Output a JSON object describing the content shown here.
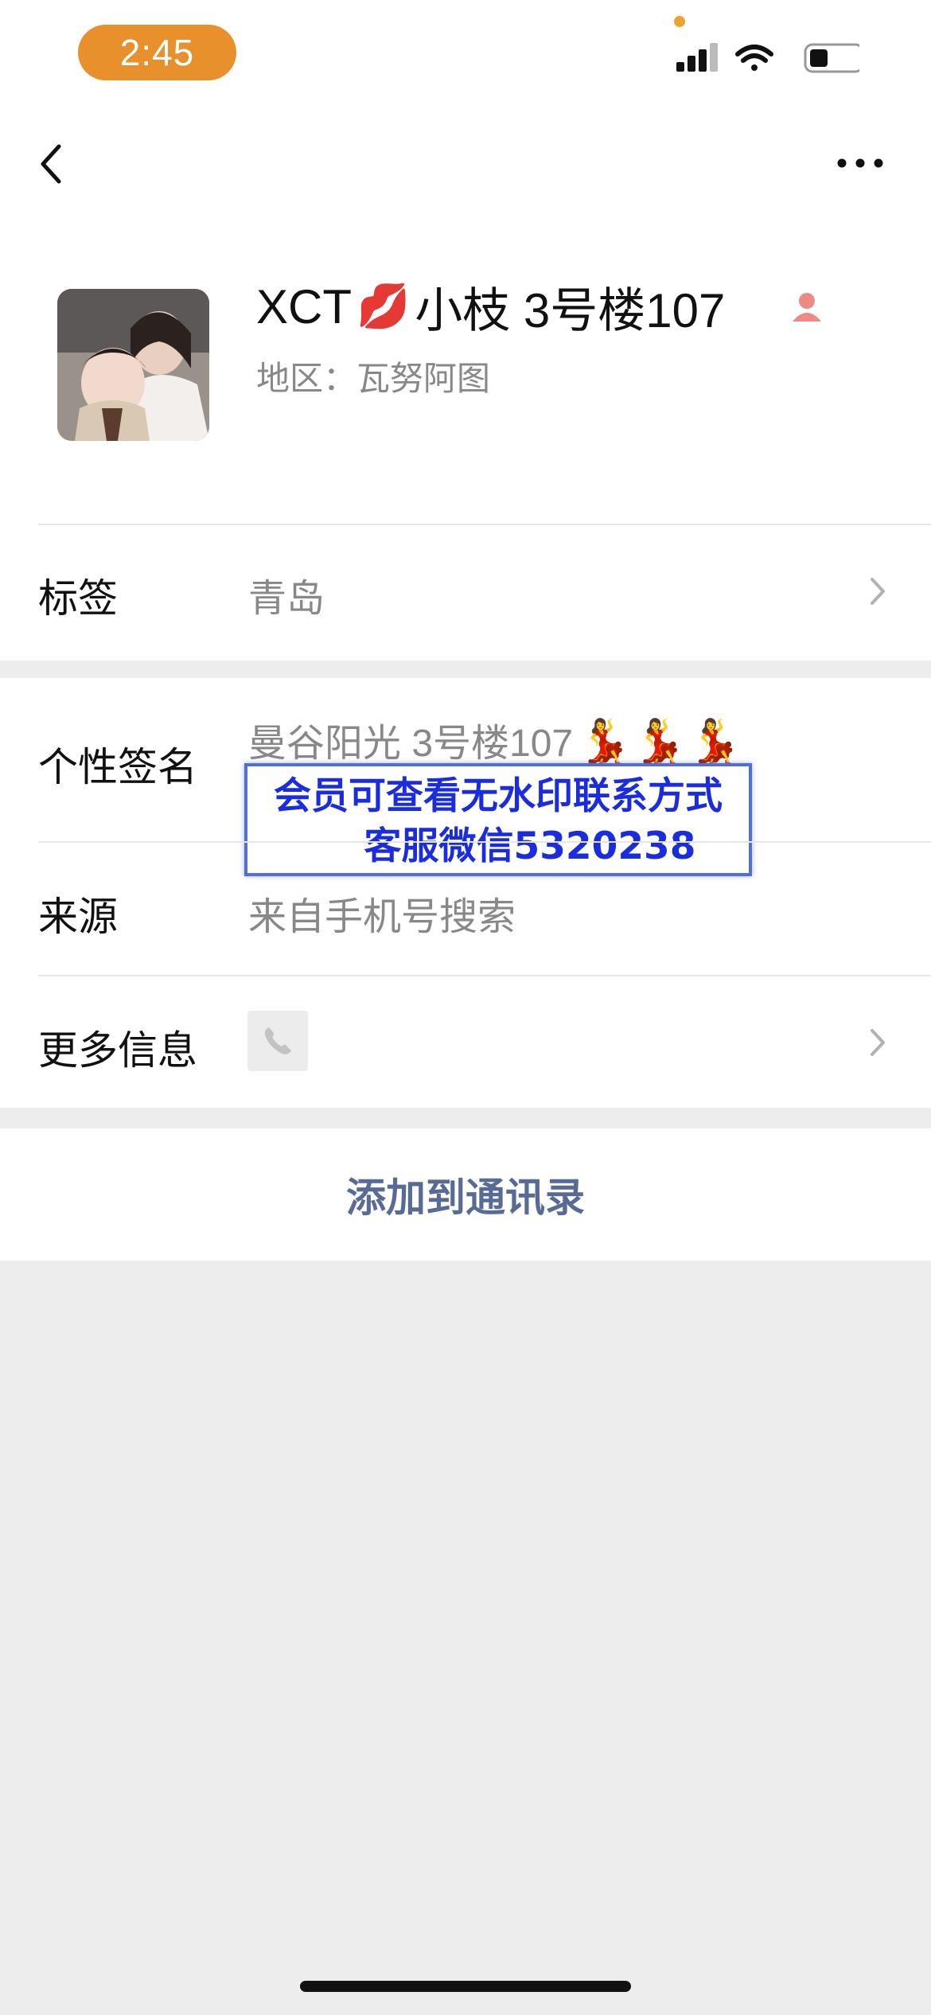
{
  "status_bar": {
    "time": "2:45"
  },
  "profile": {
    "name_prefix": "XCT",
    "name_emoji": "💋",
    "name_suffix": "小枝 3号楼107",
    "region": "地区：瓦努阿图"
  },
  "rows": {
    "tags": {
      "label": "标签",
      "value": "青岛"
    },
    "signature": {
      "label": "个性签名",
      "value": "曼谷阳光 3号楼107",
      "emoji": "💃💃💃"
    },
    "source": {
      "label": "来源",
      "value": "来自手机号搜索"
    },
    "more_info": {
      "label": "更多信息"
    }
  },
  "watermark": {
    "line1": "会员可查看无水印联系方式",
    "line2": "客服微信5320238"
  },
  "actions": {
    "add_contact": "添加到通讯录"
  },
  "colors": {
    "accent_link": "#576b95",
    "time_pill": "#e7902c",
    "watermark_text": "#1a2ce0"
  }
}
